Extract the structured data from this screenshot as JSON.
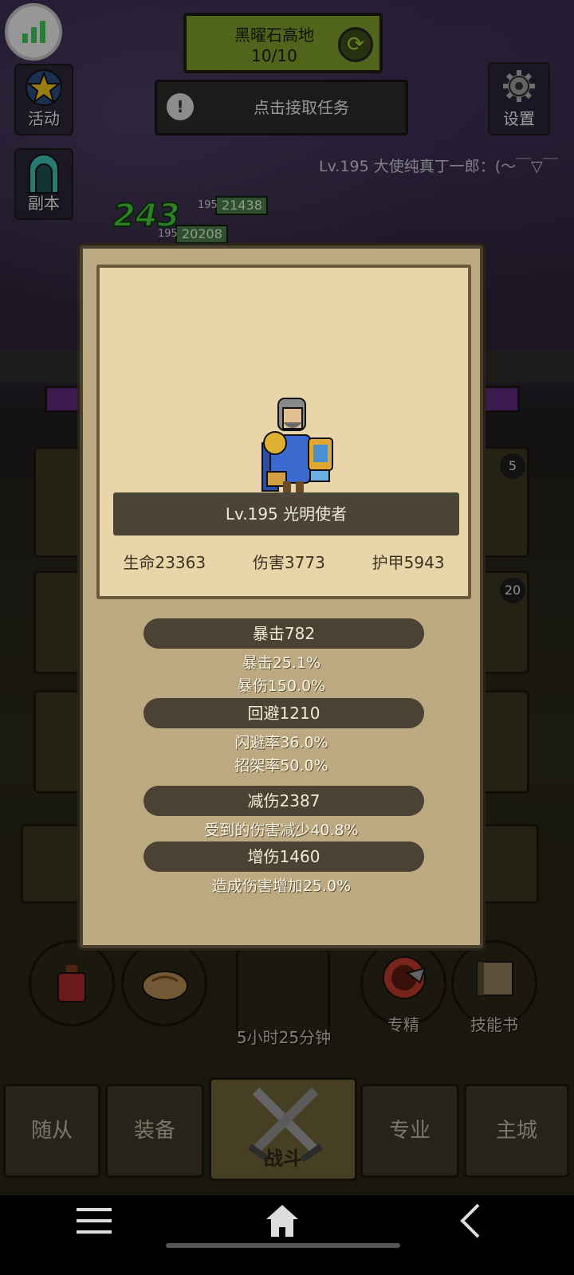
{
  "zone": {
    "name": "黑曜石高地",
    "progress": "10/10"
  },
  "task": {
    "label": "点击接取任务"
  },
  "side_buttons": {
    "activity": "活动",
    "dungeon": "副本",
    "settings": "设置"
  },
  "chat": {
    "message": "Lv.195 大使纯真丁一郎：(～￣▽￣"
  },
  "battle_hud": {
    "damage_popup": "243",
    "enemy": {
      "level": "195",
      "hp": "21438"
    },
    "player": {
      "level": "195",
      "hp": "20208"
    }
  },
  "background_badges": [
    "5",
    "20"
  ],
  "action_row": {
    "timer": "5小时25分钟",
    "specialize": "专精",
    "skill_book": "技能书"
  },
  "bottom_nav": {
    "followers": "随从",
    "equipment": "装备",
    "battle": "战斗",
    "profession": "专业",
    "main_city": "主城"
  },
  "hero_card": {
    "title": "Lv.195 光明使者",
    "hp": "生命23363",
    "damage": "伤害3773",
    "armor": "护甲5943"
  },
  "stat_groups": [
    {
      "header": "暴击782",
      "lines": [
        "暴击25.1%",
        "暴伤150.0%"
      ]
    },
    {
      "header": "回避1210",
      "lines": [
        "闪避率36.0%",
        "招架率50.0%"
      ]
    },
    {
      "header": "减伤2387",
      "lines": [
        "受到的伤害减少40.8%"
      ]
    },
    {
      "header": "增伤1460",
      "lines": [
        "造成伤害增加25.0%"
      ]
    }
  ],
  "colors": {
    "zone_green": "#7c9a2a",
    "hp_green": "#4b7a48",
    "parchment": "#e8d6aa",
    "pill": "#4a4232"
  }
}
